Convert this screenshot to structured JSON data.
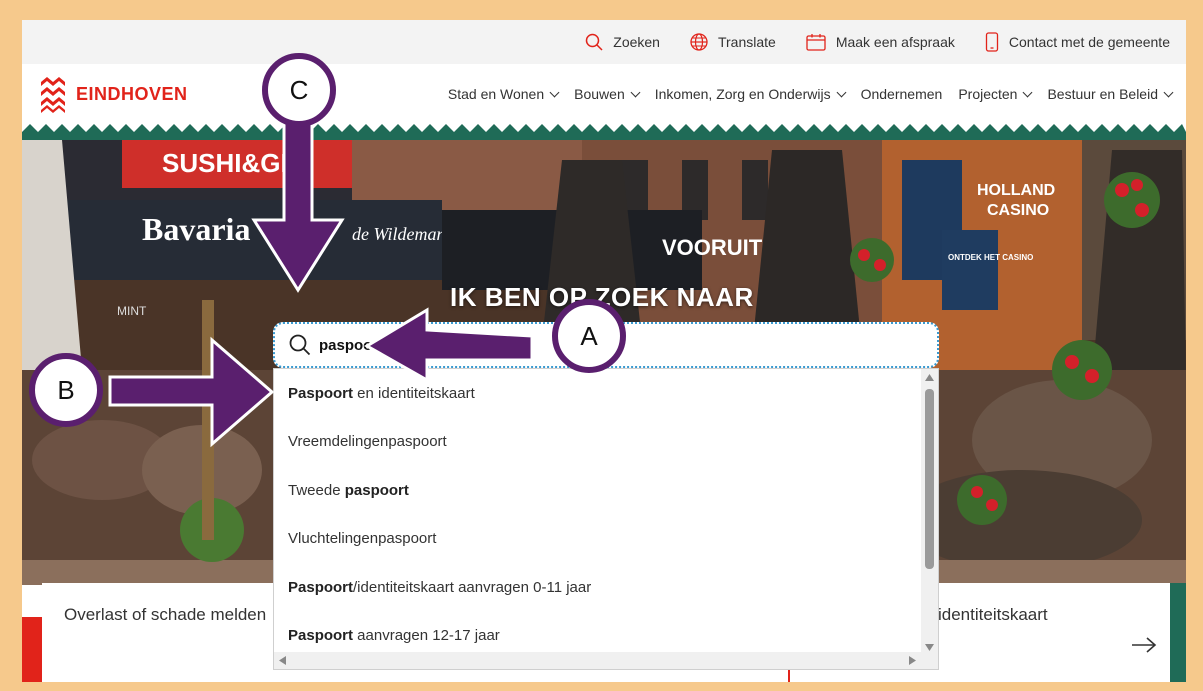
{
  "utility": {
    "search": "Zoeken",
    "translate": "Translate",
    "appointment": "Maak een afspraak",
    "contact": "Contact met de gemeente"
  },
  "logo": {
    "text": "EINDHOVEN"
  },
  "nav": [
    {
      "label": "Stad en Wonen",
      "dropdown": true
    },
    {
      "label": "Bouwen",
      "dropdown": true
    },
    {
      "label": "Inkomen, Zorg en Onderwijs",
      "dropdown": true
    },
    {
      "label": "Ondernemen",
      "dropdown": false
    },
    {
      "label": "Projecten",
      "dropdown": true
    },
    {
      "label": "Bestuur en Beleid",
      "dropdown": true
    }
  ],
  "hero": {
    "title": "IK BEN OP ZOEK NAAR",
    "signs": {
      "sushi": "SUSHI&GR",
      "bavaria": "Bavaria",
      "vooruit": "VOORUIT",
      "holland": "HOLLAND",
      "casino": "CASINO",
      "ontdek": "ONTDEK HET CASINO",
      "wildeman": "de Wildeman",
      "mint": "MINT"
    }
  },
  "search": {
    "value": "paspoort"
  },
  "suggestions": [
    {
      "bold": "Paspoort",
      "rest": " en identiteitskaart"
    },
    {
      "bold": "",
      "rest": "Vreemdelingenpaspoort"
    },
    {
      "bold": "",
      "rest": "Tweede ",
      "bold_after": "paspoort"
    },
    {
      "bold": "",
      "rest": "Vluchtelingenpaspoort"
    },
    {
      "bold": "Paspoort",
      "rest": "/identiteitskaart aanvragen 0-11 jaar"
    },
    {
      "bold": "Paspoort",
      "rest": " aanvragen 12-17 jaar"
    }
  ],
  "cards": {
    "left": "Overlast of schade melden",
    "right": "identiteitskaart"
  },
  "annotations": {
    "a": "A",
    "b": "B",
    "c": "C"
  },
  "colors": {
    "brand_red": "#e1231a",
    "zigzag_green": "#1f6b57",
    "annotation_purple": "#5a1f6e",
    "frame_border": "#f6c98c"
  }
}
